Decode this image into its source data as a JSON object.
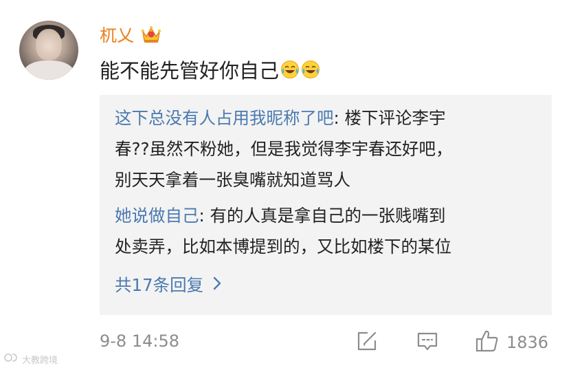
{
  "comment": {
    "username": "杌乂",
    "text": "能不能先管好你自己"
  },
  "replies": [
    {
      "author": "这下总没有人占用我昵称了吧",
      "separator": ": ",
      "line1": "楼下评论李宇",
      "line2": "春??虽然不粉她，但是我觉得李宇春还好吧，",
      "line3": "别天天拿着一张臭嘴就知道骂人"
    },
    {
      "author": "她说做自己",
      "separator": ": ",
      "line1": "有的人真是拿自己的一张贱嘴到",
      "line2": "处卖弄，比如本博提到的，又比如楼下的某位"
    }
  ],
  "more_replies": "共17条回复",
  "footer": {
    "timestamp": "9-8 14:58",
    "like_count": "1836"
  },
  "watermark": "大教跨境",
  "icons": {
    "vip": "crown-icon",
    "emoji": "laugh-cry-emoji-icon",
    "repost": "repost-icon",
    "comment": "comment-icon",
    "like": "thumbs-up-icon",
    "more": "chevron-right-icon"
  },
  "colors": {
    "username": "#e8841f",
    "link": "#4a79b0",
    "meta": "#8c8c8c",
    "reply_bg": "#f3f3f3"
  }
}
